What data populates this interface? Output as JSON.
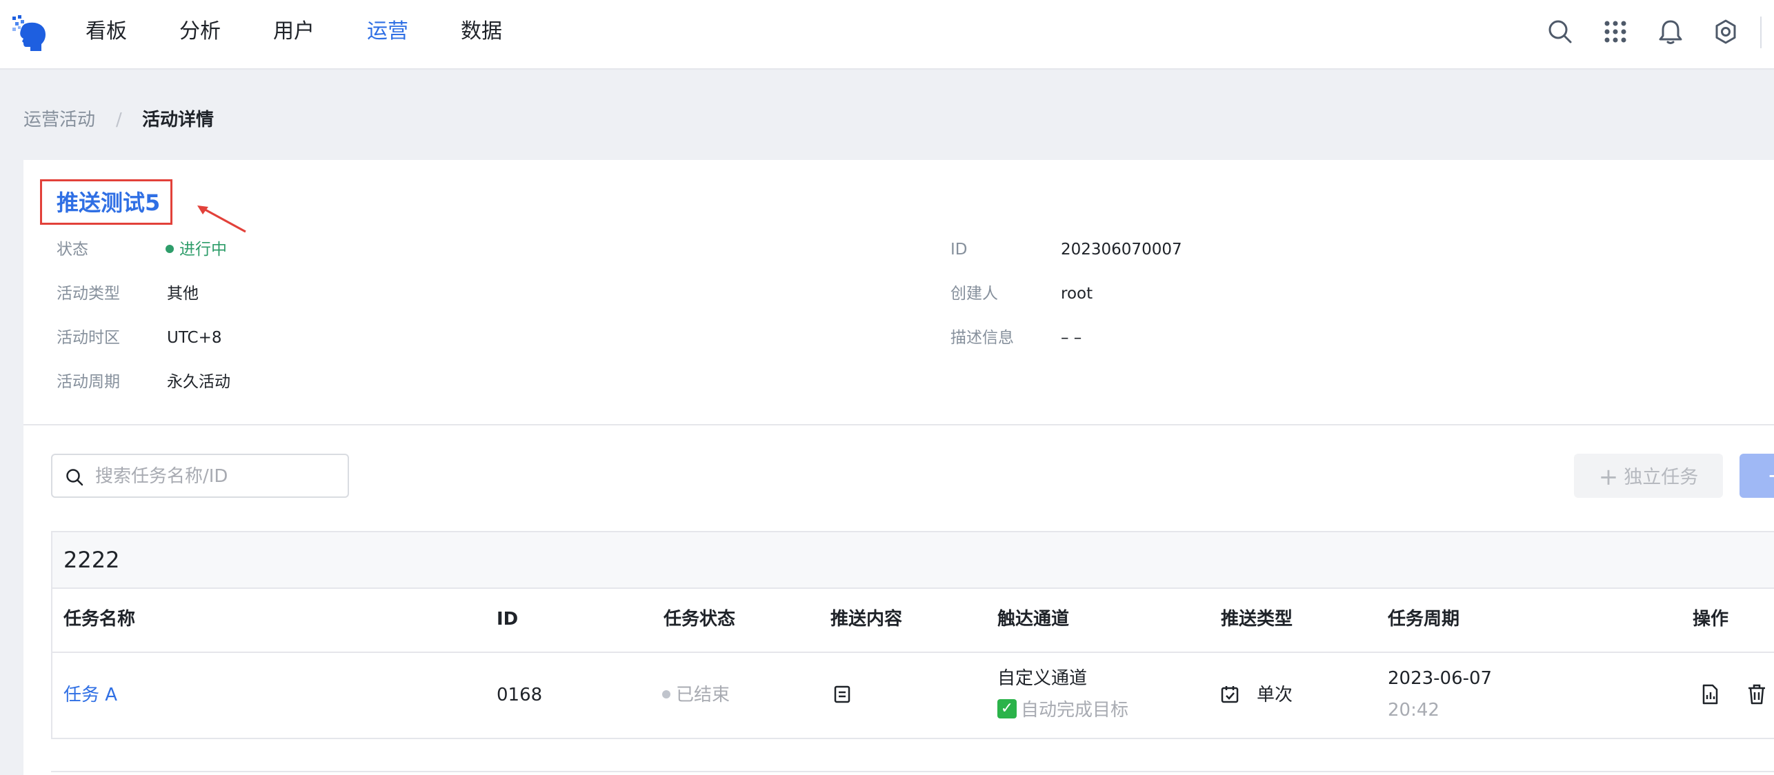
{
  "nav": {
    "items": [
      "看板",
      "分析",
      "用户",
      "运营",
      "数据"
    ],
    "active": "运营"
  },
  "header_icons": [
    "search-icon",
    "apps-grid-icon",
    "bell-icon",
    "gear-icon"
  ],
  "breadcrumb": {
    "parent": "运营活动",
    "separator": "/",
    "current": "活动详情"
  },
  "activity": {
    "title": "推送测试5",
    "info_left": [
      {
        "label": "状态",
        "value": "进行中",
        "status_color": "#2e9d6a"
      },
      {
        "label": "活动类型",
        "value": "其他"
      },
      {
        "label": "活动时区",
        "value": "UTC+8"
      },
      {
        "label": "活动周期",
        "value": "永久活动"
      }
    ],
    "info_right": [
      {
        "label": "ID",
        "value": "202306070007"
      },
      {
        "label": "创建人",
        "value": "root"
      },
      {
        "label": "描述信息",
        "value": "– –"
      }
    ]
  },
  "toolbar": {
    "search_placeholder": "搜索任务名称/ID",
    "standalone_task_label": "独立任务",
    "create_label": "+"
  },
  "group": {
    "title": "2222",
    "columns": [
      "任务名称",
      "ID",
      "任务状态",
      "推送内容",
      "触达通道",
      "推送类型",
      "任务周期",
      "操作"
    ],
    "rows": [
      {
        "name": "任务 A",
        "id": "0168",
        "status": "已结束",
        "channel": "自定义通道",
        "channel_note": "自动完成目标",
        "push_type": "单次",
        "period_date": "2023-06-07",
        "period_time": "20:42"
      }
    ]
  },
  "colors": {
    "accent": "#2f6fe4",
    "running": "#2e9d6a",
    "annotation": "#e2413a"
  }
}
